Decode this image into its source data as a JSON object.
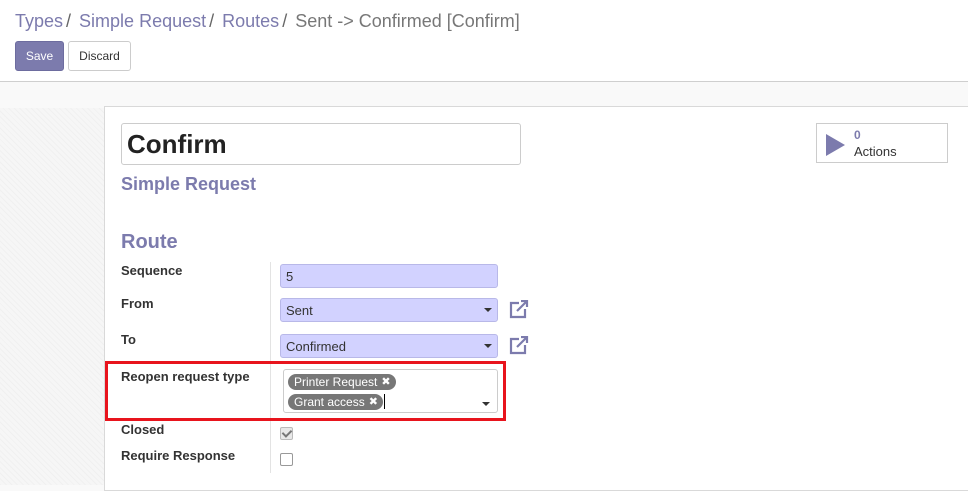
{
  "breadcrumb": {
    "items": [
      "Types",
      "Simple Request",
      "Routes"
    ],
    "separator": "/",
    "active": "Sent -> Confirmed [Confirm]"
  },
  "toolbar": {
    "save_label": "Save",
    "discard_label": "Discard"
  },
  "record": {
    "name": "Confirm",
    "request_type": "Simple Request"
  },
  "stat_button": {
    "count": "0",
    "label": "Actions",
    "icon": "play-icon"
  },
  "route_group": {
    "title": "Route",
    "fields": {
      "sequence": {
        "label": "Sequence",
        "value": "5"
      },
      "from": {
        "label": "From",
        "value": "Sent"
      },
      "to": {
        "label": "To",
        "value": "Confirmed"
      },
      "reopen": {
        "label": "Reopen request type",
        "tags": [
          "Printer Request",
          "Grant access"
        ]
      },
      "closed": {
        "label": "Closed",
        "checked": true
      },
      "require_response": {
        "label": "Require Response",
        "checked": false
      }
    }
  },
  "colors": {
    "primary": "#7c7bad",
    "field_bg": "#d2d2ff",
    "highlight": "#e8141d"
  }
}
